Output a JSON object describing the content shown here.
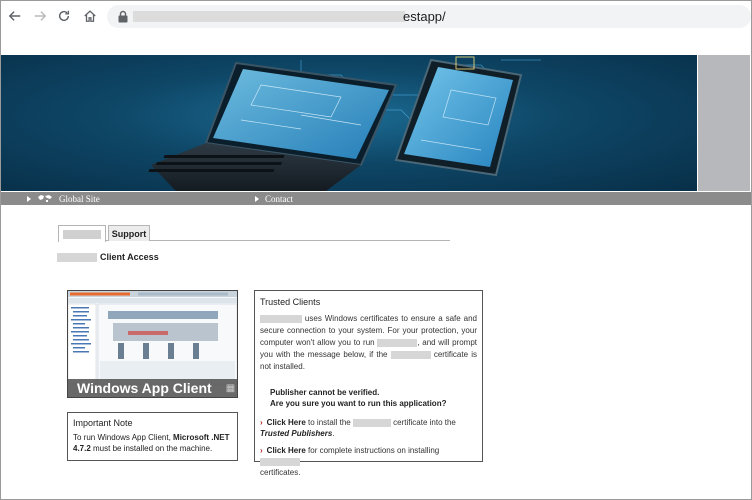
{
  "browser": {
    "url_suffix": "estapp/"
  },
  "nav": {
    "global_site": "Global Site",
    "contact": "Contact"
  },
  "tabs": {
    "support": "Support"
  },
  "heading": {
    "client_access": "Client Access"
  },
  "thumbnail": {
    "caption": "Windows App Client"
  },
  "note": {
    "title": "Important Note",
    "text_before": "To run Windows App Client, ",
    "requirement": "Microsoft .NET 4.7.2",
    "text_after": " must be installed on the machine."
  },
  "trusted": {
    "title": "Trusted Clients",
    "p1": " uses Windows certificates to ensure a safe and secure connection to your system. For your protection, your computer won't allow you to run ",
    "p2": ", and will prompt you with the message below, if the ",
    "p3": " certificate is not installed.",
    "warning_line1": "Publisher cannot be verified.",
    "warning_line2": "Are you sure you want to run this application?",
    "link1_label": "Click Here",
    "link1_text_a": " to install the ",
    "link1_text_b": " certificate into the ",
    "link1_target": "Trusted Publishers",
    "link1_end": ".",
    "link2_label": "Click Here",
    "link2_text": " for complete instructions on installing ",
    "link2_end": " certificates."
  },
  "colors": {
    "banner_dark": "#082f48",
    "nav_gray": "#8b8b8b",
    "link_arrow": "#b22222"
  }
}
